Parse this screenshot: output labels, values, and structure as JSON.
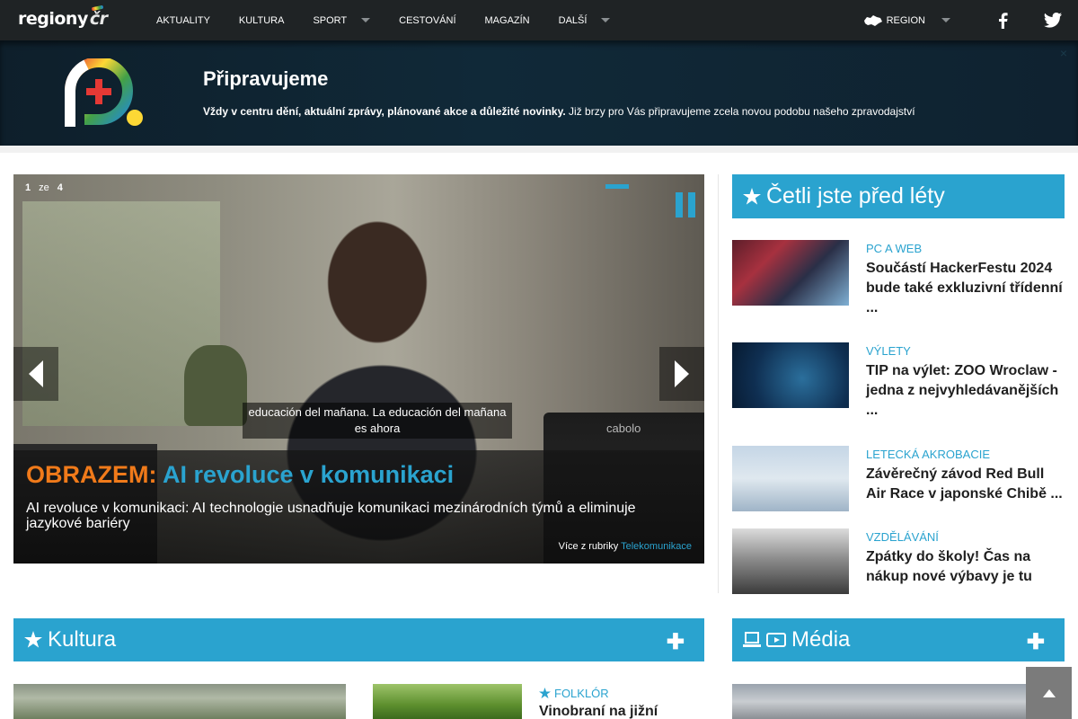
{
  "nav": {
    "logo_main": "regiony",
    "logo_suffix": "čr",
    "items": [
      {
        "label": "AKTUALITY",
        "has_dropdown": false
      },
      {
        "label": "KULTURA",
        "has_dropdown": false
      },
      {
        "label": "SPORT",
        "has_dropdown": true
      },
      {
        "label": "CESTOVÁNÍ",
        "has_dropdown": false
      },
      {
        "label": "MAGAZÍN",
        "has_dropdown": false
      },
      {
        "label": "DALŠÍ",
        "has_dropdown": true
      }
    ],
    "region_label": "REGION",
    "social": [
      "facebook-icon",
      "twitter-icon"
    ]
  },
  "banner": {
    "title": "Připravujeme",
    "text_bold": "Vždy v centru dění, aktuální zprávy, plánované akce a důležité novinky.",
    "text_rest": " Již brzy pro Vás připravujeme zcela novou podobu našeho zpravodajství",
    "close": "×"
  },
  "slider": {
    "current": "1",
    "of": "ze",
    "total": "4",
    "subtitle": "educación del mañana. La educación del mañana es ahora",
    "device_brand": "cabolo",
    "title_prefix": "OBRAZEM:",
    "title": "AI revoluce v komunikaci",
    "description": "AI revoluce v komunikaci: AI technologie usnadňuje komunikaci mezinárodních týmů a eliminuje jazykové bariéry",
    "more_label": "Více z rubriky",
    "more_link": "Telekomunikace"
  },
  "read_before": {
    "heading": "Četli jste před léty",
    "articles": [
      {
        "category": "PC A WEB",
        "title": "Součástí HackerFestu 2024 bude také exkluzivní třídenní ..."
      },
      {
        "category": "VÝLETY",
        "title": "TIP na výlet: ZOO Wroclaw - jedna z nejvyhledávanějších ..."
      },
      {
        "category": "LETECKÁ AKROBACIE",
        "title": "Závěrečný závod Red Bull Air Race v japonské Chibě ..."
      },
      {
        "category": "VZDĚLÁVÁNÍ",
        "title": "Zpátky do školy! Čas na nákup nové výbavy je tu"
      }
    ]
  },
  "kultura": {
    "heading": "Kultura",
    "plus": "✚",
    "article_category": "FOLKLÓR",
    "article_title": "Vinobraní na jižní"
  },
  "media": {
    "heading": "Média",
    "plus": "✚"
  },
  "colors": {
    "accent": "#2aa3cf",
    "orange": "#f07a1a",
    "nav_bg": "#1f2325",
    "banner_bg": "#0f2230"
  }
}
